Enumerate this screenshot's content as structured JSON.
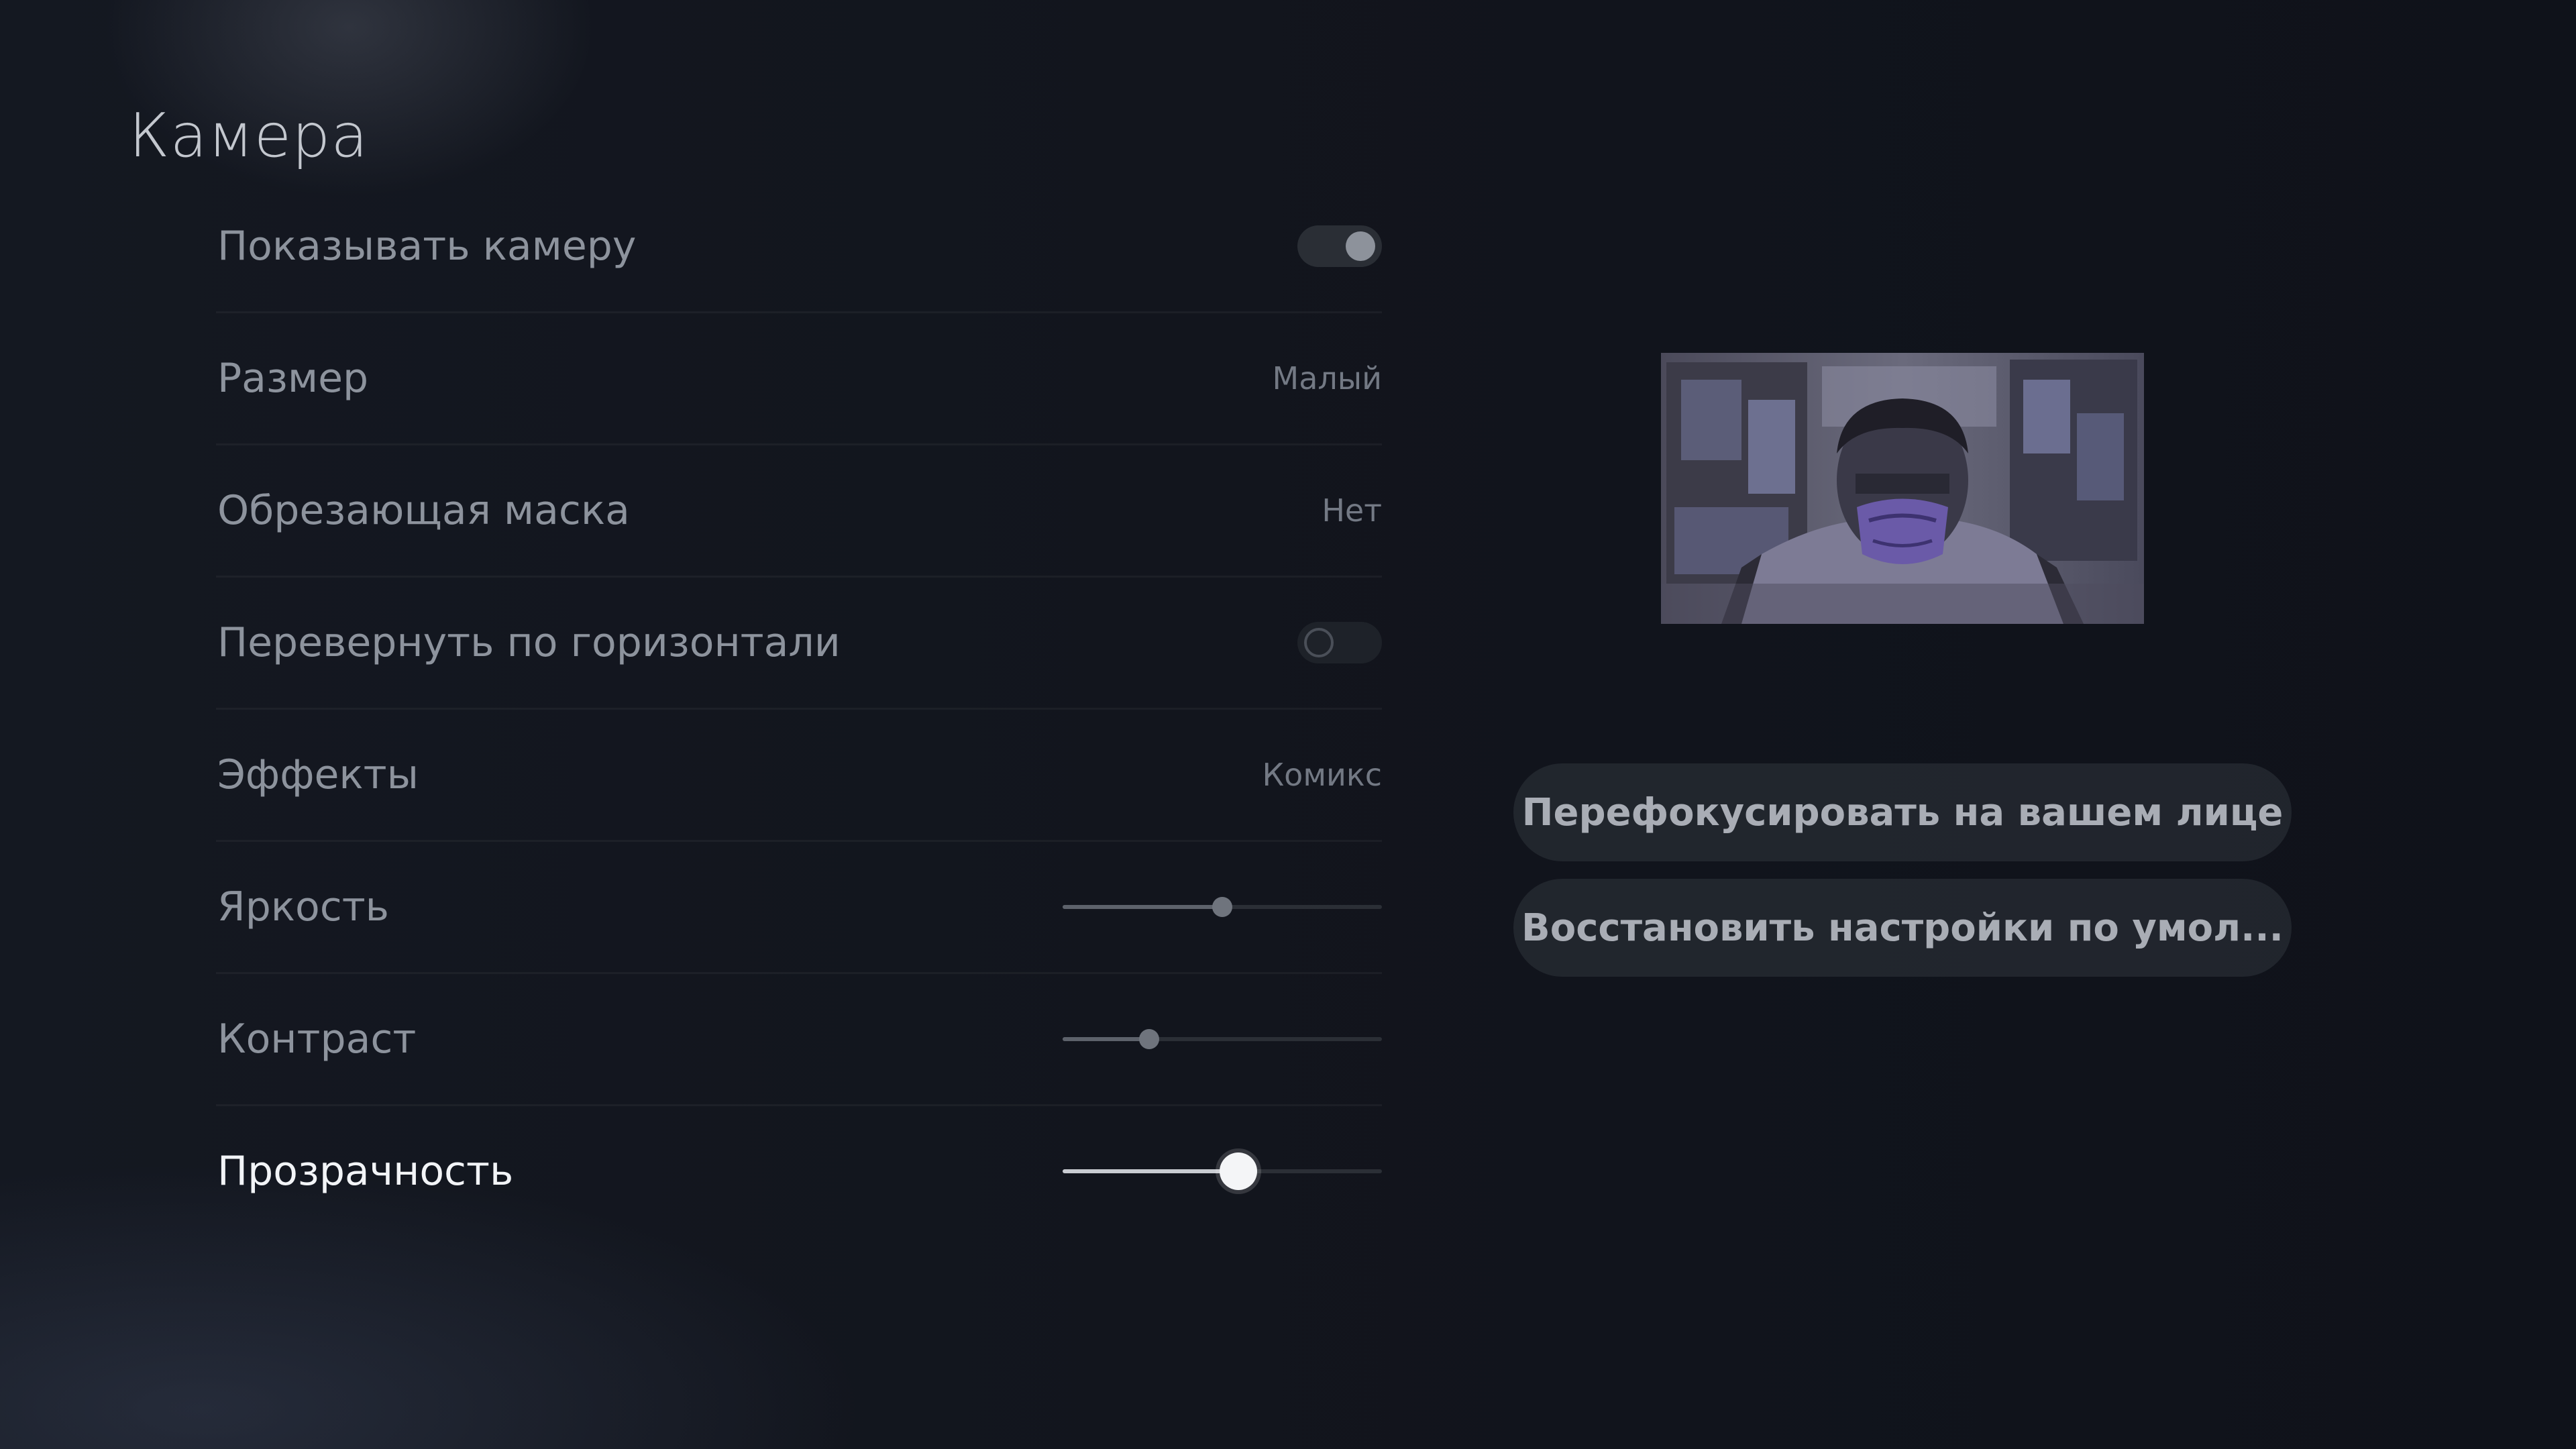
{
  "header": {
    "title": "Камера"
  },
  "settings": [
    {
      "label": "Показывать камеру",
      "control": "toggle",
      "state": "on"
    },
    {
      "label": "Размер",
      "control": "value",
      "value": "Малый"
    },
    {
      "label": "Обрезающая маска",
      "control": "value",
      "value": "Нет"
    },
    {
      "label": "Перевернуть по горизонтали",
      "control": "toggle",
      "state": "off"
    },
    {
      "label": "Эффекты",
      "control": "value",
      "value": "Комикс"
    },
    {
      "label": "Яркость",
      "control": "slider",
      "level": 0.5
    },
    {
      "label": "Контраст",
      "control": "slider",
      "level": 0.27
    },
    {
      "label": "Прозрачность",
      "control": "slider",
      "level": 0.55,
      "focused": true
    }
  ],
  "preview": {
    "description_icon": "camera-preview"
  },
  "actions": {
    "refocus_label": "Перефокусировать на вашем лице",
    "reset_label": "Восстановить настройки по умол..."
  },
  "colors": {
    "background": "#10131a",
    "text_dim": "#8d939d",
    "text_focused": "#f2f4f7"
  }
}
